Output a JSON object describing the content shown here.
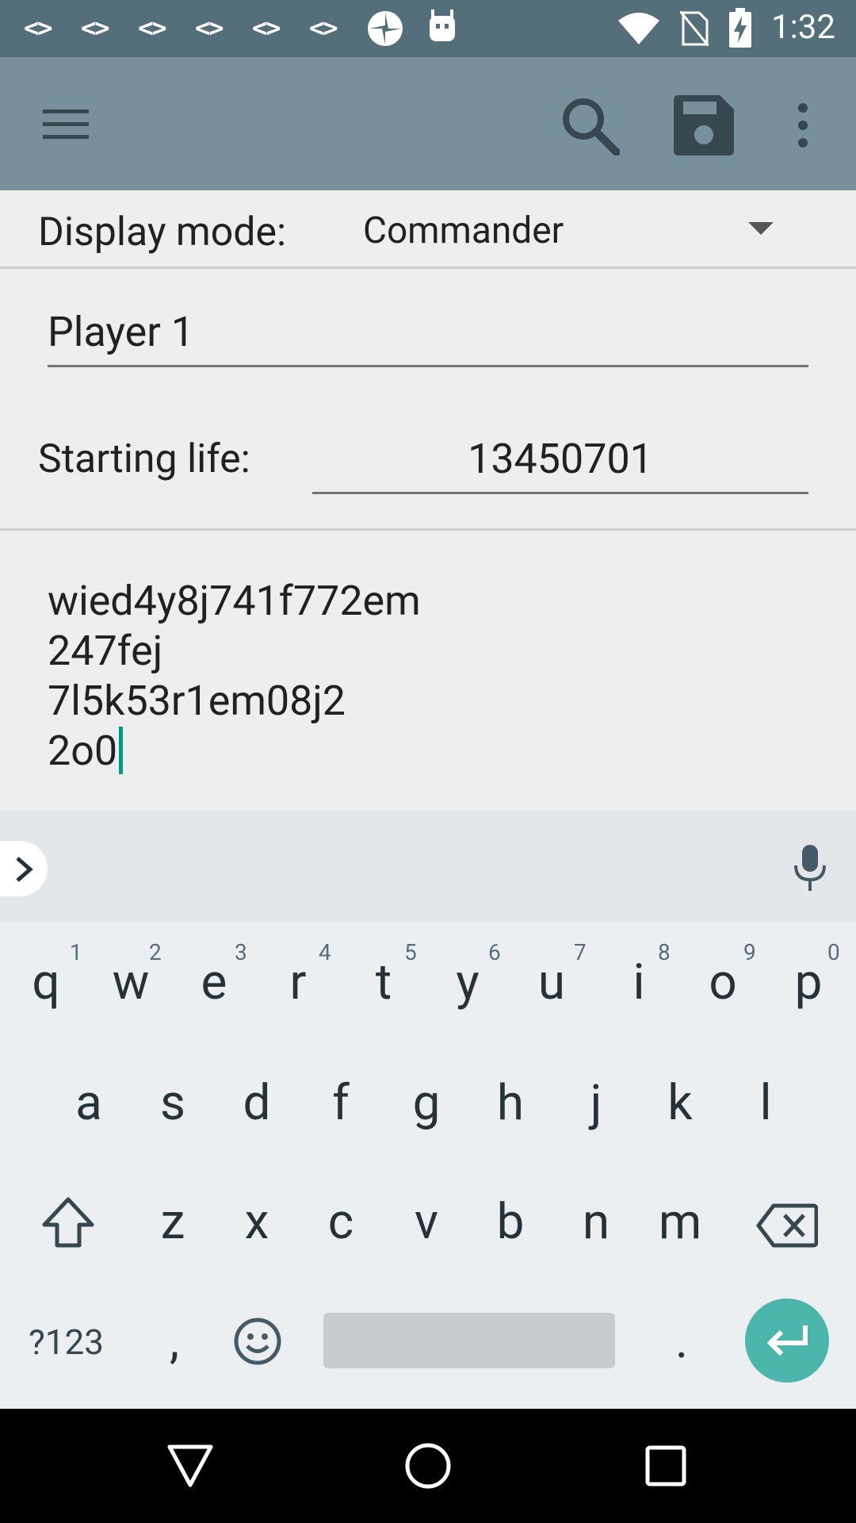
{
  "status_bar": {
    "notification_codes": [
      "<>",
      "<>",
      "<>",
      "<>",
      "<>",
      "<>"
    ],
    "icons": [
      "pinwheel-icon",
      "android-icon",
      "wifi-icon",
      "no-sim-icon",
      "battery-charging-icon"
    ],
    "time": "1:32"
  },
  "toolbar": {
    "background": "#78909c",
    "icons": [
      "menu-icon",
      "search-icon",
      "save-icon",
      "overflow-menu-icon"
    ]
  },
  "display_mode": {
    "label": "Display mode:",
    "value": "Commander"
  },
  "player": {
    "name": "Player 1"
  },
  "starting_life": {
    "label": "Starting life:",
    "value": "13450701"
  },
  "notes": {
    "lines": [
      "wied4y8j741f772em",
      "247fej",
      "7l5k53r1em08j2",
      "2o0"
    ]
  },
  "keyboard": {
    "row1": [
      "q",
      "w",
      "e",
      "r",
      "t",
      "y",
      "u",
      "i",
      "o",
      "p"
    ],
    "row1_hints": [
      "1",
      "2",
      "3",
      "4",
      "5",
      "6",
      "7",
      "8",
      "9",
      "0"
    ],
    "row2": [
      "a",
      "s",
      "d",
      "f",
      "g",
      "h",
      "j",
      "k",
      "l"
    ],
    "row3": [
      "z",
      "x",
      "c",
      "v",
      "b",
      "n",
      "m"
    ],
    "symbols_key": "?123",
    "comma_key": ",",
    "period_key": ".",
    "enter_color": "#4db6ac"
  },
  "nav_bar": {
    "icons": [
      "back-icon",
      "home-icon",
      "recents-icon"
    ]
  }
}
